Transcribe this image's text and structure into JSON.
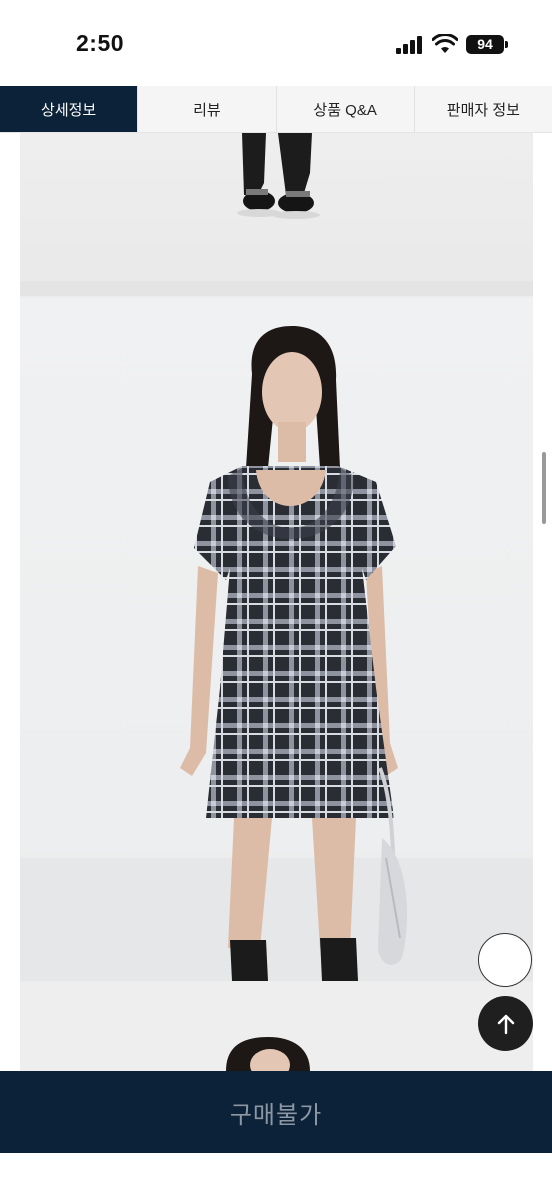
{
  "status_bar": {
    "time": "2:50",
    "battery": "94"
  },
  "tabs": [
    {
      "label": "상세정보",
      "active": true
    },
    {
      "label": "리뷰",
      "active": false
    },
    {
      "label": "상품 Q&A",
      "active": false
    },
    {
      "label": "판매자 정보",
      "active": false
    }
  ],
  "floating": {
    "top_icon": "arrow-up-icon"
  },
  "purchase": {
    "label": "구매불가"
  }
}
